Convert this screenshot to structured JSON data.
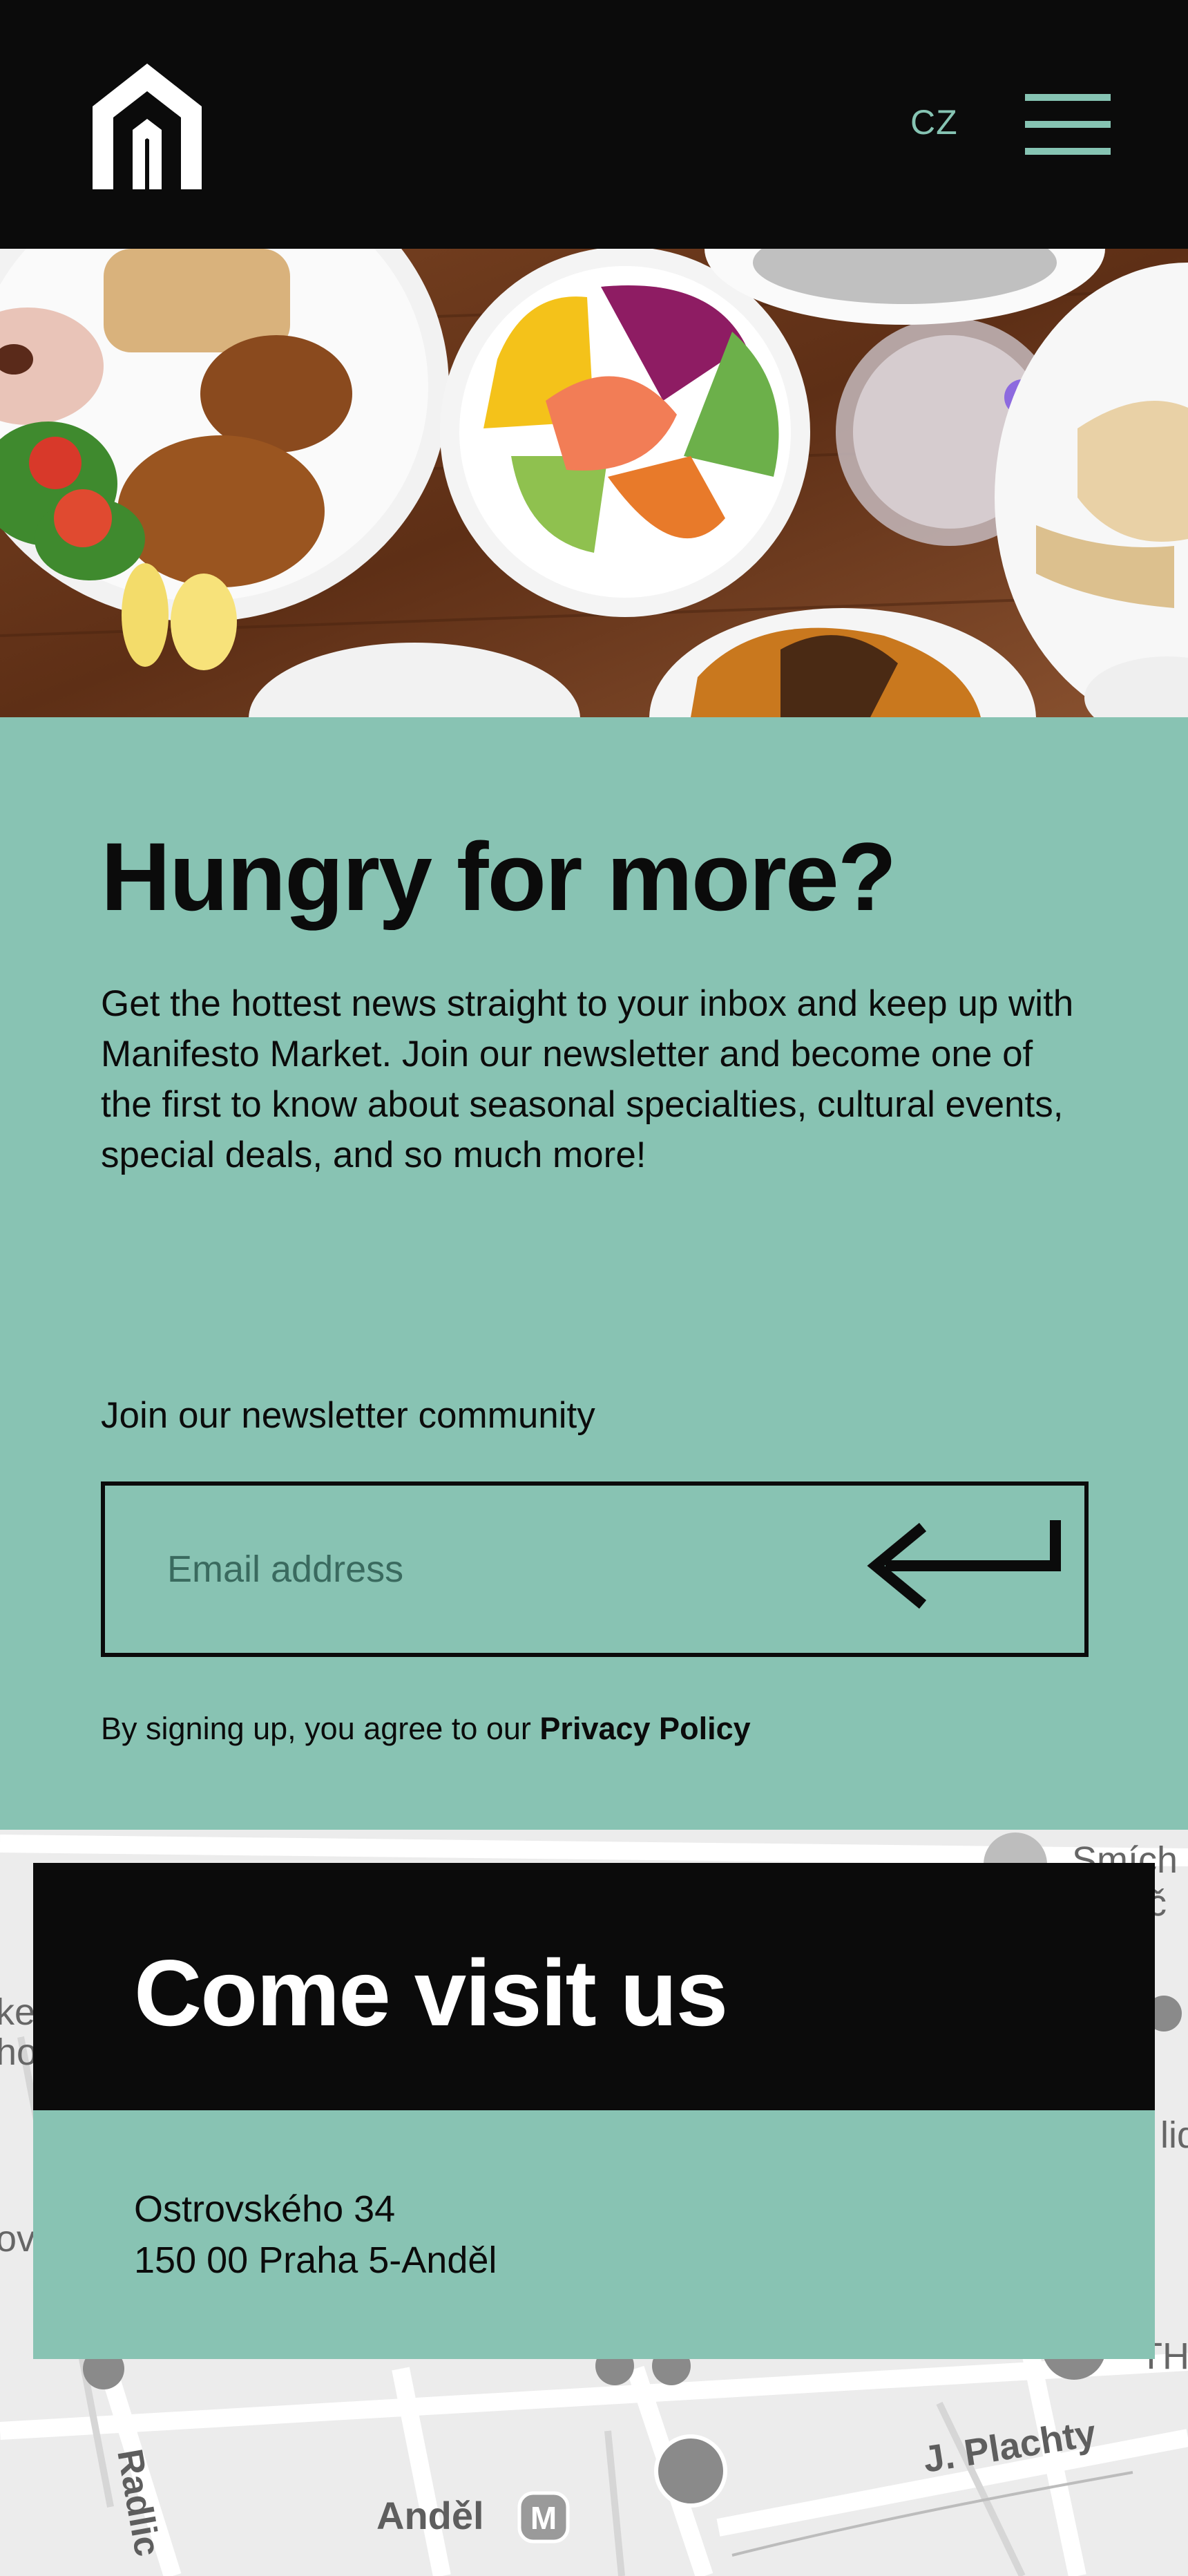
{
  "header": {
    "logo_icon": "manifesto-house-logo",
    "language_label": "CZ",
    "menu_icon": "hamburger-menu-icon"
  },
  "hero": {
    "image": "food-table-photo"
  },
  "newsletter": {
    "title": "Hungry for more?",
    "body": "Get the hottest news straight to your inbox and keep up with Manifesto Market. Join our newsletter and become one of the first to know about seasonal specialties, cultural events, special deals, and so much more!",
    "label": "Join our newsletter community",
    "email_placeholder": "Email address",
    "submit_icon": "enter-arrow-icon",
    "legal_prefix": "By signing up, you agree to our",
    "privacy_link": "Privacy Policy"
  },
  "map": {
    "labels": {
      "smich_1": "Smích",
      "smich_2": "nič",
      "left_1": "ke",
      "left_2": "ho",
      "left_3": "ov",
      "right_1": "lid",
      "th": "TH",
      "street_plachty": "J. Plachty",
      "street_radlic": "Radlic",
      "andel": "Anděl",
      "metro": "M"
    }
  },
  "visit": {
    "title": "Come visit us",
    "address_line1": "Ostrovského 34",
    "address_line2": "150 00 Praha 5-Anděl"
  },
  "colors": {
    "black": "#0b0b0b",
    "mint": "#88c3b3",
    "mint_text": "#86c4b3"
  }
}
